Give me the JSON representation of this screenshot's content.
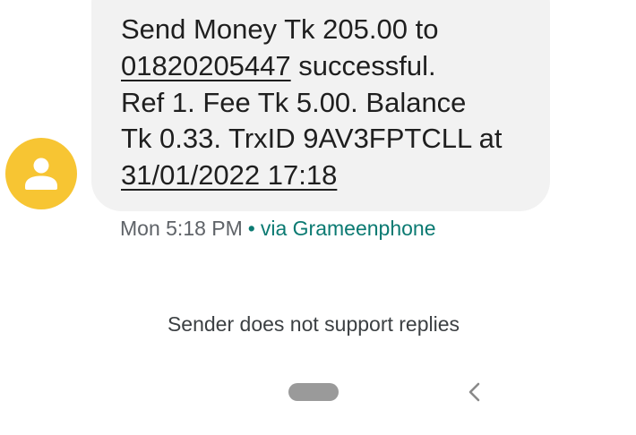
{
  "message": {
    "line1": "Send Money Tk 205.00 to",
    "phone_link": "01820205447",
    "line2_rest": " successful.",
    "line3": "Ref 1. Fee Tk 5.00. Balance",
    "line4": "Tk 0.33. TrxID 9AV3FPTCLL at",
    "datetime_link": "31/01/2022 17:18"
  },
  "meta": {
    "time": "Mon 5:18 PM",
    "separator": "•",
    "carrier": "via Grameenphone"
  },
  "notice": "Sender does not support replies",
  "colors": {
    "avatar_bg": "#f7c533",
    "bubble_bg": "#f2f2f2",
    "accent_teal": "#0b7a72"
  },
  "icons": {
    "avatar": "person-icon",
    "nav_home": "home-pill",
    "nav_back": "back-chevron-icon"
  }
}
